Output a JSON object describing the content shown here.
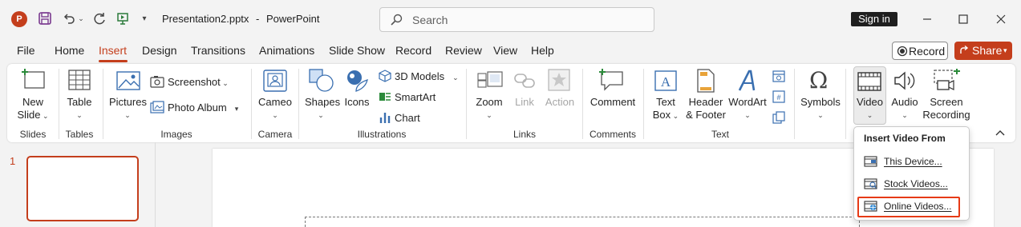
{
  "titlebar": {
    "app_letter": "P",
    "filename": "Presentation2.pptx",
    "separator": "-",
    "app_name": "PowerPoint",
    "search_placeholder": "Search",
    "sign_in": "Sign in"
  },
  "tabs": [
    "File",
    "Home",
    "Insert",
    "Design",
    "Transitions",
    "Animations",
    "Slide Show",
    "Record",
    "Review",
    "View",
    "Help"
  ],
  "active_tab": "Insert",
  "record_button": "Record",
  "share_button": "Share",
  "ribbon": {
    "new_slide": [
      "New",
      "Slide"
    ],
    "table": "Table",
    "pictures": "Pictures",
    "screenshot": "Screenshot",
    "photo_album": "Photo Album",
    "cameo": "Cameo",
    "shapes": "Shapes",
    "icons": "Icons",
    "models_3d": "3D Models",
    "smartart": "SmartArt",
    "chart": "Chart",
    "zoom": "Zoom",
    "link": "Link",
    "action": "Action",
    "comment": "Comment",
    "text_box": [
      "Text",
      "Box"
    ],
    "header_footer": [
      "Header",
      "& Footer"
    ],
    "wordart": "WordArt",
    "symbols": "Symbols",
    "video": "Video",
    "audio": "Audio",
    "screen_recording": [
      "Screen",
      "Recording"
    ],
    "groups": {
      "slides": "Slides",
      "tables": "Tables",
      "images": "Images",
      "camera": "Camera",
      "illustrations": "Illustrations",
      "links": "Links",
      "comments": "Comments",
      "text": "Text"
    }
  },
  "slide_pane": {
    "slide_number": "1"
  },
  "video_menu": {
    "title": "Insert Video From",
    "items": [
      "This Device...",
      "Stock Videos...",
      "Online Videos..."
    ],
    "highlighted": "Online Videos..."
  },
  "colors": {
    "accent": "#c43e1c",
    "highlight_box": "#e63a16"
  }
}
